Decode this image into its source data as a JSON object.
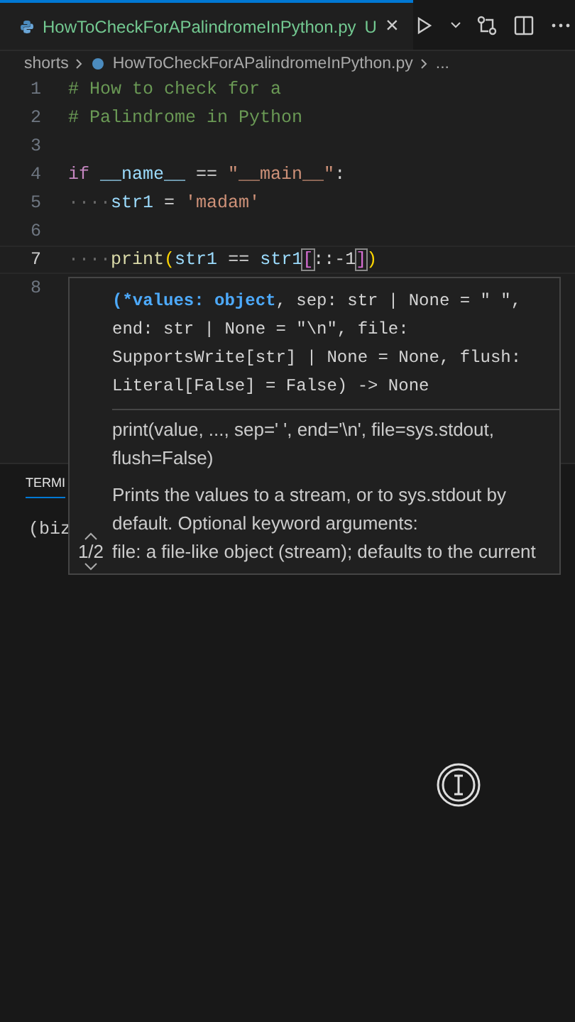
{
  "tabs": [
    {
      "label": "HowToCheckForAPalindromeInPython.py",
      "badge": "U",
      "close": "×",
      "selected": true
    }
  ],
  "breadcrumb": [
    "shorts",
    "HowToCheckForAPalindromeInPython.py",
    "..."
  ],
  "code_lines": [
    {
      "number": "1",
      "current": false,
      "tokens": [
        {
          "kind": "comment",
          "text": "# How to check for a"
        }
      ]
    },
    {
      "number": "2",
      "current": false,
      "tokens": [
        {
          "kind": "comment",
          "text": "# Palindrome in Python"
        }
      ]
    },
    {
      "number": "3",
      "current": false
    },
    {
      "number": "4",
      "current": false,
      "tokens": [
        {
          "kind": "keyword",
          "text": "if"
        },
        {
          "kind": "variable",
          "text": " __name__"
        },
        {
          "kind": "plain",
          "text": " == "
        },
        {
          "kind": "string",
          "text": "\"__main__\""
        },
        {
          "kind": "plain",
          "text": ":"
        }
      ]
    },
    {
      "number": "5",
      "current": false,
      "tokens": [
        {
          "kind": "whitespace",
          "text": "····"
        },
        {
          "kind": "variable",
          "text": "str1"
        },
        {
          "kind": "plain",
          "text": " = "
        },
        {
          "kind": "string",
          "text": "'madam'"
        }
      ]
    },
    {
      "number": "6",
      "current": false
    },
    {
      "number": "7",
      "current": true,
      "tokens": [
        {
          "kind": "whitespace",
          "text": "····"
        },
        {
          "kind": "function",
          "text": "print"
        },
        {
          "kind": "bracket",
          "text": "("
        },
        {
          "kind": "variable",
          "text": "str1"
        },
        {
          "kind": "plain",
          "text": " == "
        },
        {
          "kind": "variable",
          "text": "str1"
        },
        {
          "kind": "bracket-match",
          "text": "["
        },
        {
          "kind": "plain",
          "text": "::-1"
        },
        {
          "kind": "bracket-match",
          "text": "]"
        },
        {
          "kind": "bracket",
          "text": ")"
        }
      ]
    },
    {
      "number": "8",
      "current": false
    }
  ],
  "hover": {
    "signature": [
      {
        "kind": "active-param",
        "text": "(*values: object"
      },
      {
        "kind": "plain",
        "text": ", sep: str | None = \" \", end: str | None = \"\\n\", file: SupportsWrite[str] | None = None, flush: Literal[False] = False) -> None"
      }
    ],
    "usage": "print(value, ..., sep=' ', end='\\n', file=sys.stdout, flush=False)",
    "description": "Prints the values to a stream, or to sys.stdout by default. Optional keyword arguments:",
    "detail": "file: a file-like object (stream); defaults to the current",
    "pager": "1/2"
  },
  "panel": {
    "tab": "TERMI",
    "prompt": "(biz"
  }
}
